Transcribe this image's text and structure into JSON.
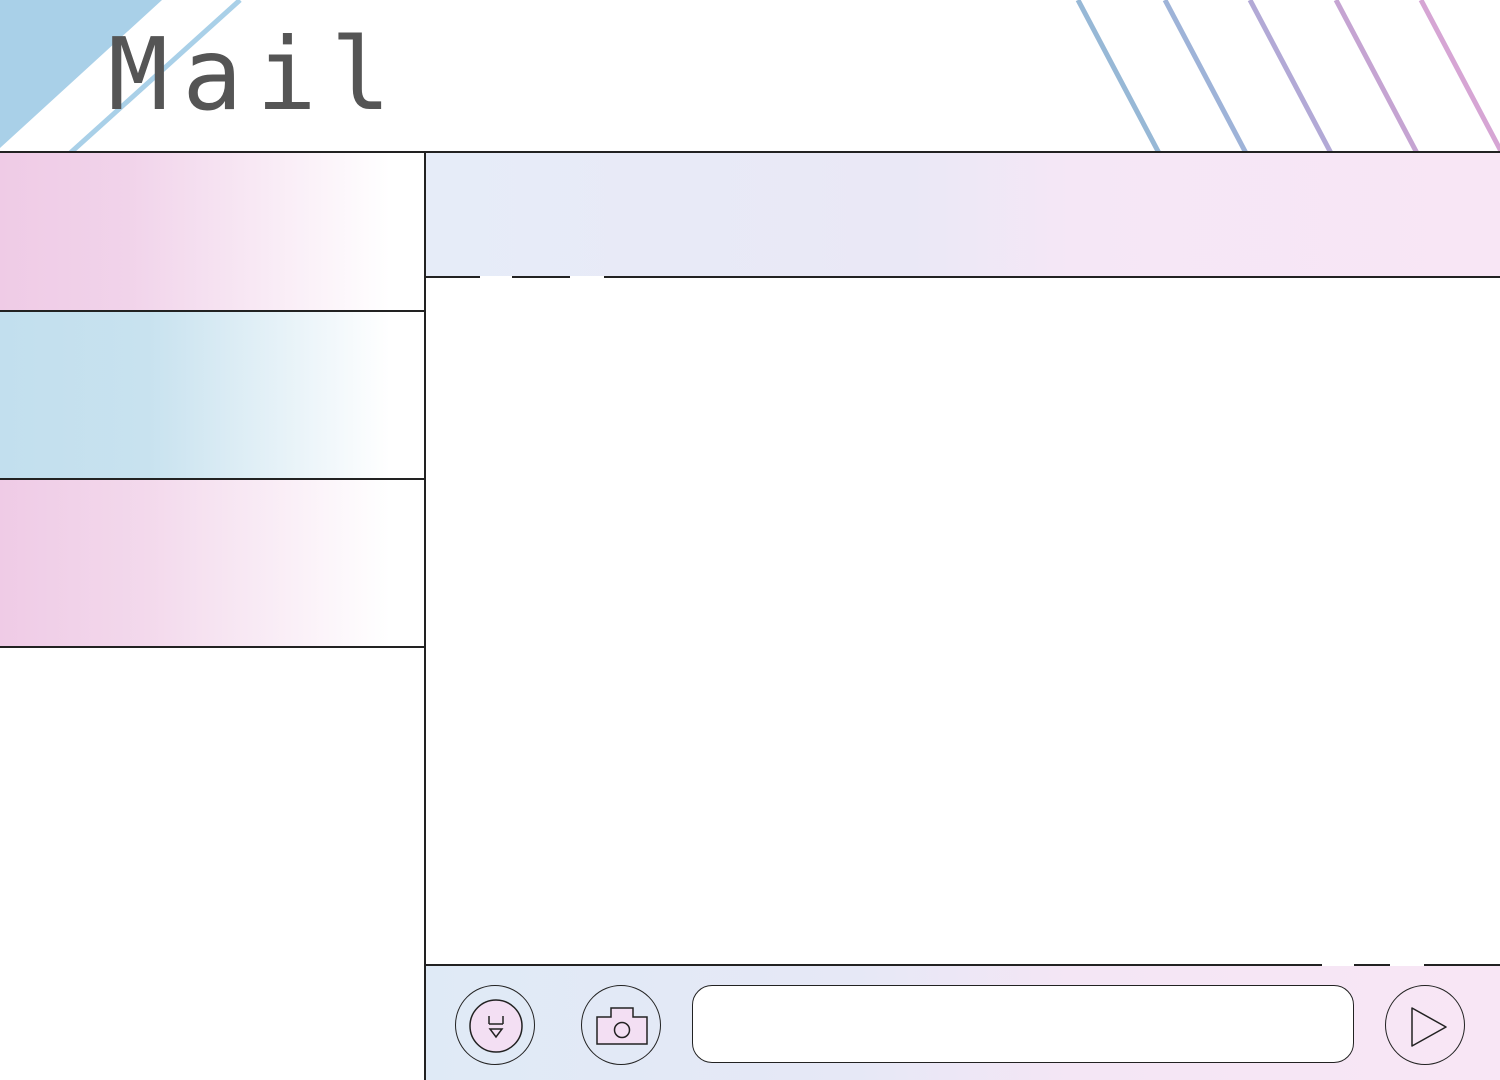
{
  "app": {
    "title": "Mail"
  },
  "sidebar": {
    "items": [
      {
        "label": ""
      },
      {
        "label": ""
      },
      {
        "label": ""
      }
    ]
  },
  "chat": {
    "header_title": "",
    "messages": []
  },
  "composer": {
    "input_value": "",
    "input_placeholder": "",
    "buttons": {
      "emoji_icon": "face-icon",
      "camera_icon": "camera-icon",
      "send_icon": "send-arrow-icon"
    }
  },
  "colors": {
    "pink": "#efcbe6",
    "blue": "#c2dfee",
    "header_blue": "#e6ecf8",
    "header_pink": "#f8e6f5",
    "deco_blue": "#a9d0e8",
    "title_gray": "#555555",
    "line": "#222222"
  }
}
